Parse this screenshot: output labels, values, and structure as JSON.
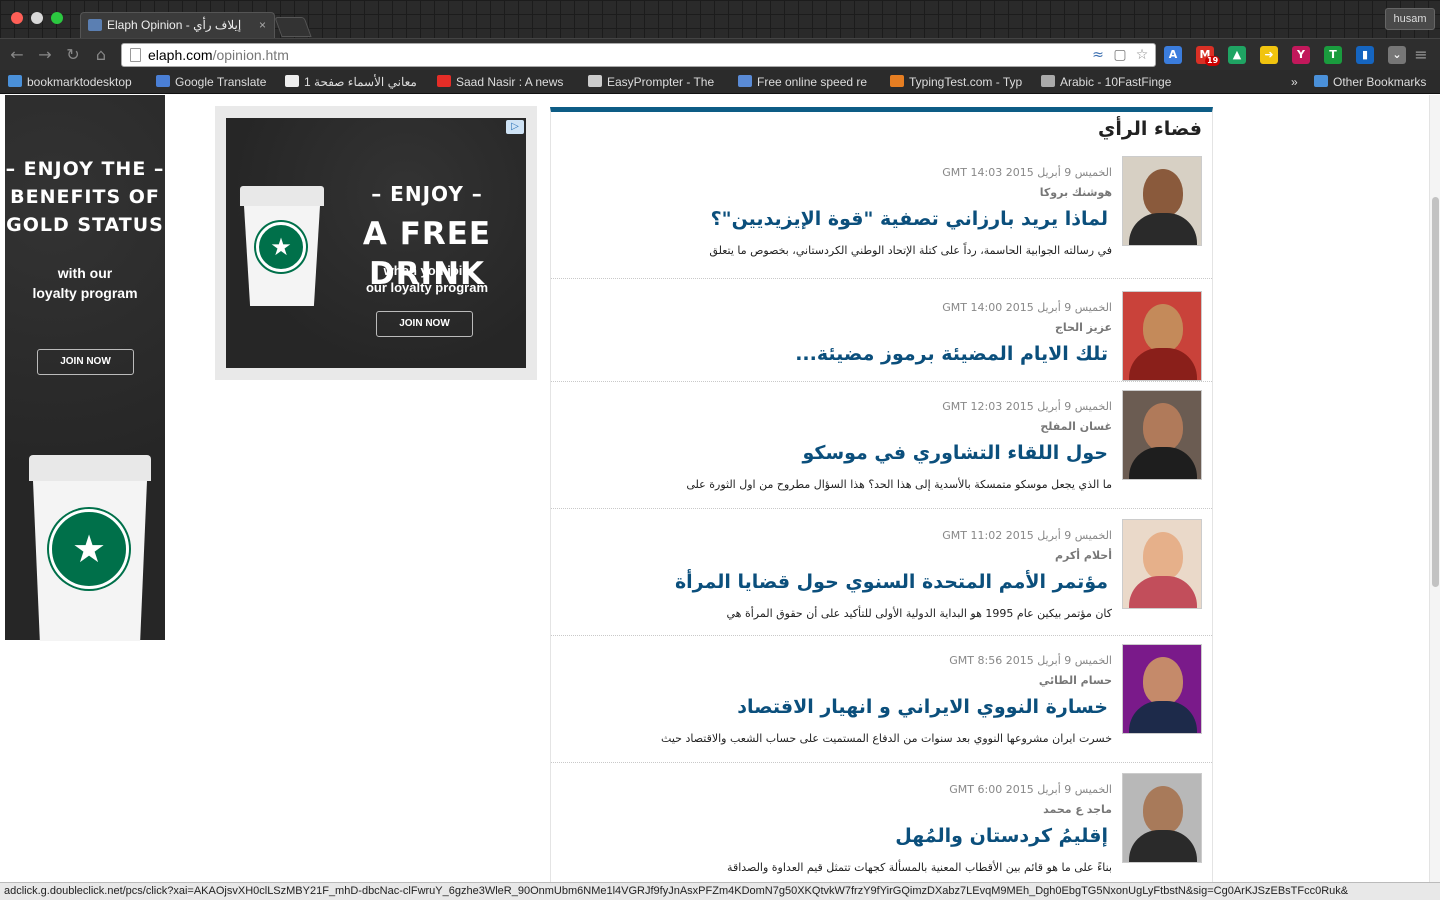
{
  "browser": {
    "tab_title": "Elaph Opinion - إيلاف رأي",
    "tab_close": "×",
    "profile": "husam",
    "url_host": "elaph.com",
    "url_path": "/opinion.htm",
    "nav_icons": [
      "back-arrow-icon",
      "forward-arrow-icon",
      "reload-icon",
      "home-icon"
    ],
    "extensions": [
      {
        "name": "translate-extension-icon",
        "glyph": "A",
        "color": "#3b7ddd"
      },
      {
        "name": "gmail-extension-icon",
        "glyph": "M",
        "badge": "19",
        "color": "#d93025"
      },
      {
        "name": "drive-extension-icon",
        "glyph": "▲",
        "color": "#1fa463"
      },
      {
        "name": "arrow-extension-icon",
        "glyph": "➜",
        "color": "#f1c40f"
      },
      {
        "name": "y-extension-icon",
        "glyph": "Y",
        "color": "#c2185b"
      },
      {
        "name": "t-extension-icon",
        "glyph": "T",
        "color": "#1a9c3e"
      },
      {
        "name": "chart-extension-icon",
        "glyph": "▮",
        "color": "#1565c0"
      },
      {
        "name": "pocket-extension-icon",
        "glyph": "⌄",
        "color": "#777"
      }
    ]
  },
  "bookmarks": [
    {
      "label": "bookmarktodesktop",
      "icon": "folder-icon",
      "color": "#4a90d9"
    },
    {
      "label": "Google Translate",
      "icon": "translate-icon",
      "color": "#4a7fd6"
    },
    {
      "label": "معاني الأسماء صفحة 1",
      "icon": "names-site-icon",
      "color": "#eeeeee"
    },
    {
      "label": "Saad Nasir : A news",
      "icon": "youtube-icon",
      "color": "#e52d27"
    },
    {
      "label": "EasyPrompter - The",
      "icon": "ep-icon",
      "color": "#cccccc"
    },
    {
      "label": "Free online speed re",
      "icon": "speed-reading-icon",
      "color": "#5a8bd6"
    },
    {
      "label": "TypingTest.com - Typ",
      "icon": "typingtest-icon",
      "color": "#e67e22"
    },
    {
      "label": "Arabic - 10FastFinge",
      "icon": "10fastfingers-icon",
      "color": "#aaaaaa"
    },
    {
      "label": "»",
      "icon": "",
      "color": ""
    },
    {
      "label": "Other Bookmarks",
      "icon": "folder-icon",
      "color": "#4a90d9"
    }
  ],
  "ads": {
    "skyscraper": {
      "headline": "– ENJOY THE –\nBENEFITS OF\nGOLD STATUS",
      "sub": "with our\nloyalty program",
      "button": "JOIN NOW"
    },
    "rectangle": {
      "headline1": "– ENJOY –",
      "headline2": "A FREE DRINK",
      "sub": "when you join\nour loyalty program",
      "button": "JOIN NOW"
    },
    "brand_color": "#00704a"
  },
  "section": {
    "title": "فضاء الرأي",
    "accent_color": "#0d5c85",
    "title_color": "#0b4f7c"
  },
  "articles": [
    {
      "date": "الخميس 9 أبريل 2015 GMT 14:03",
      "author": "هوشنك بروكا",
      "title": "لماذا يريد بارزاني تصفية \"قوة الإيزيديين\"؟",
      "excerpt": "في رسالته الجوابية الحاسمة، رداً على كتلة الإتحاد الوطني الكردستاني، بخصوص ما يتعلق"
    },
    {
      "date": "الخميس 9 أبريل 2015 GMT 14:00",
      "author": "عزيز الحاج",
      "title": "تلك الايام المضيئة برموز مضيئة...",
      "excerpt": ""
    },
    {
      "date": "الخميس 9 أبريل 2015 GMT 12:03",
      "author": "غسان المفلح",
      "title": "حول اللقاء التشاوري في موسكو",
      "excerpt": "ما الذي يجعل موسكو متمسكة بالأسدية إلى هذا الحد؟ هذا السؤال مطروح من اول الثورة على"
    },
    {
      "date": "الخميس 9 أبريل 2015 GMT 11:02",
      "author": "أحلام أكرم",
      "title": "مؤتمر الأمم المتحدة السنوي حول قضايا المرأة",
      "excerpt": "كان مؤتمر بيكين عام 1995 هو البداية الدولية الأولى للتأكيد على أن حقوق المرأة هي"
    },
    {
      "date": "الخميس 9 أبريل 2015 GMT 8:56",
      "author": "حسام الطائي",
      "title": "خسارة النووي الايراني و انهيار الاقتصاد",
      "excerpt": "خسرت ايران مشروعها النووي بعد سنوات من الدفاع المستميت على حساب الشعب والاقتصاد حيث"
    },
    {
      "date": "الخميس 9 أبريل 2015 GMT 6:00",
      "author": "ماجد ع محمد",
      "title": "إقليمُ كردستان والمُهل",
      "excerpt": "بناءً على ما هو قائم بين الأقطاب المعنية بالمسألة كجهات تتمثل قيم العداوة والصداقة"
    }
  ],
  "status_url": "adclick.g.doubleclick.net/pcs/click?xai=AKAOjsvXH0clLSzMBY21F_mhD-dbcNac-clFwruY_6gzhe3WleR_90OnmUbm6NMe1l4VGRJf9fyJnAsxPFZm4KDomN7g50XKQtvkW7frzY9fYirGQimzDXabz7LEvqM9MEh_Dgh0EbgTG5NxonUgLyFtbstN&sig=Cg0ArKJSzEBsTFcc0Ruk&"
}
